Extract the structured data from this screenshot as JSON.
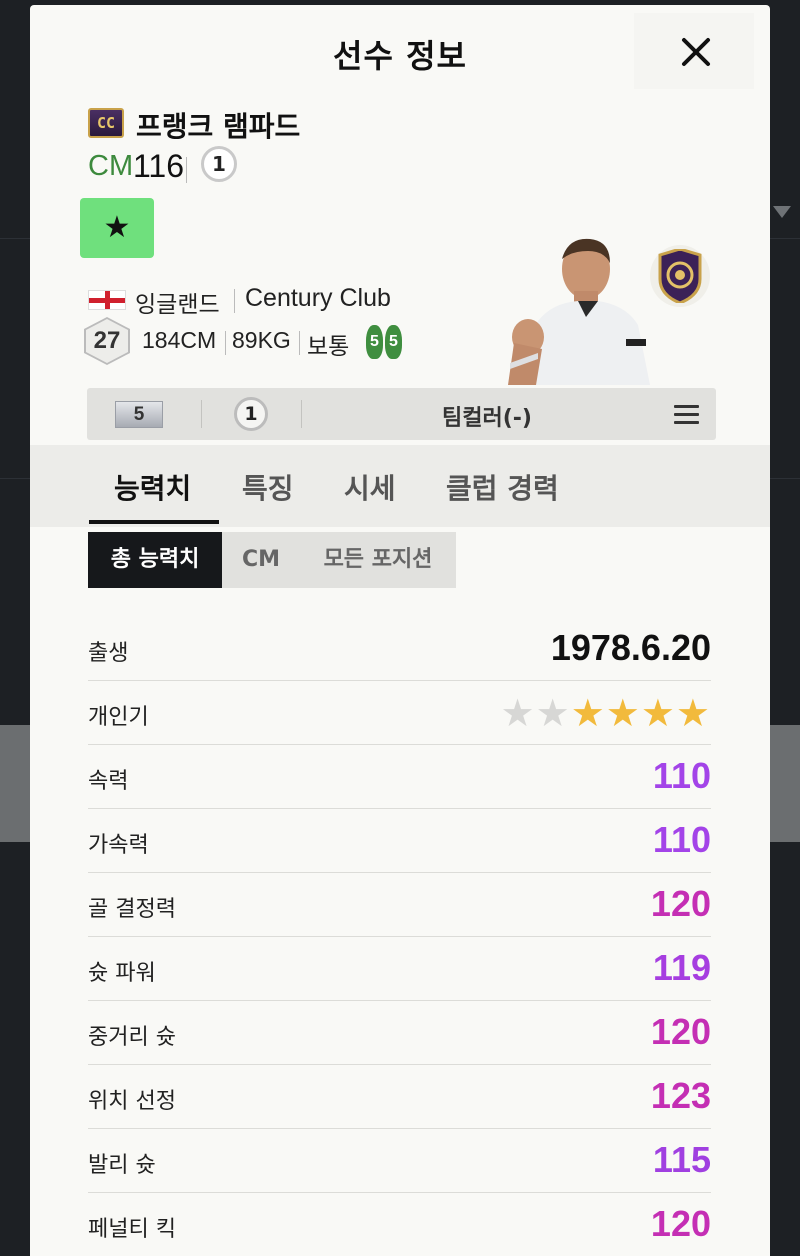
{
  "modal": {
    "title": "선수 정보",
    "close_icon": "close-icon"
  },
  "player": {
    "season_badge": "CC",
    "name": "프랭크 램파드",
    "position": "CM",
    "ovr": "116",
    "grade": "1",
    "star_symbol": "★",
    "nation": "잉글랜드",
    "club": "Century Club",
    "age": "27",
    "height": "184CM",
    "weight": "89KG",
    "body_type": "보통",
    "left_foot": "5",
    "right_foot": "5"
  },
  "info_bar": {
    "level": "5",
    "grade": "1",
    "team_color": "팀컬러(-)"
  },
  "tabs": [
    {
      "label": "능력치",
      "active": true
    },
    {
      "label": "특징",
      "active": false
    },
    {
      "label": "시세",
      "active": false
    },
    {
      "label": "클럽 경력",
      "active": false
    }
  ],
  "subtabs": [
    {
      "label": "총 능력치",
      "active": true
    },
    {
      "label": "CM",
      "active": false
    },
    {
      "label": "모든 포지션",
      "active": false
    }
  ],
  "stats": {
    "birth": {
      "label": "출생",
      "value": "1978.6.20"
    },
    "popularity": {
      "label": "개인기",
      "filled": 4,
      "total": 6
    },
    "rows": [
      {
        "label": "속력",
        "value": "110"
      },
      {
        "label": "가속력",
        "value": "110"
      },
      {
        "label": "골 결정력",
        "value": "120"
      },
      {
        "label": "슛 파워",
        "value": "119"
      },
      {
        "label": "중거리 슛",
        "value": "120"
      },
      {
        "label": "위치 선정",
        "value": "123"
      },
      {
        "label": "발리 슛",
        "value": "115"
      },
      {
        "label": "페널티 킥",
        "value": "120"
      }
    ]
  },
  "colors": {
    "accent_green": "#3d8a3d",
    "star_gold": "#f2ba3c",
    "stat_110": "#a344e8",
    "stat_115": "#a040e0",
    "stat_119": "#a63ee0",
    "stat_120": "#c42fb4",
    "stat_123": "#c42fb4"
  }
}
